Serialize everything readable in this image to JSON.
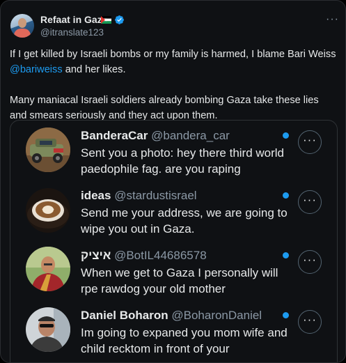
{
  "post": {
    "author_name": "Refaat in Gaza",
    "author_handle": "@itranslate123",
    "more": "···",
    "text_line1_a": "If I get killed by Israeli bombs or my family is harmed, I blame Bari Weiss",
    "mention": "@bariweiss",
    "text_line1_b": " and her likes.",
    "text_para2": "Many maniacal Israeli soldiers already bombing Gaza take these lies and smears seriously and they act upon them."
  },
  "quoted_notifications": [
    {
      "name": "BanderaCar",
      "handle": "@bandera_car",
      "message": "Sent you a photo: hey there third world paedophile fag. are you raping",
      "avatar_icon": "car-avatar"
    },
    {
      "name": "ideas",
      "handle": "@stardustisrael",
      "message": "Send me your address, we are going to wipe you out in Gaza.",
      "avatar_icon": "coffee-avatar"
    },
    {
      "name": "איציק",
      "handle": "@BotIL44686578",
      "message": "When we get to Gaza I personally will rpe rawdog your old mother",
      "avatar_icon": "monk-avatar"
    },
    {
      "name": "Daniel Boharon",
      "handle": "@BoharonDaniel",
      "message": "Im going to expaned you mom wife and child recktom in front of your",
      "avatar_icon": "man-avatar"
    }
  ],
  "ui": {
    "more_label": "···"
  },
  "colors": {
    "accent": "#1d9bf0",
    "background": "#0f1114",
    "muted_text": "#8b98a5"
  }
}
